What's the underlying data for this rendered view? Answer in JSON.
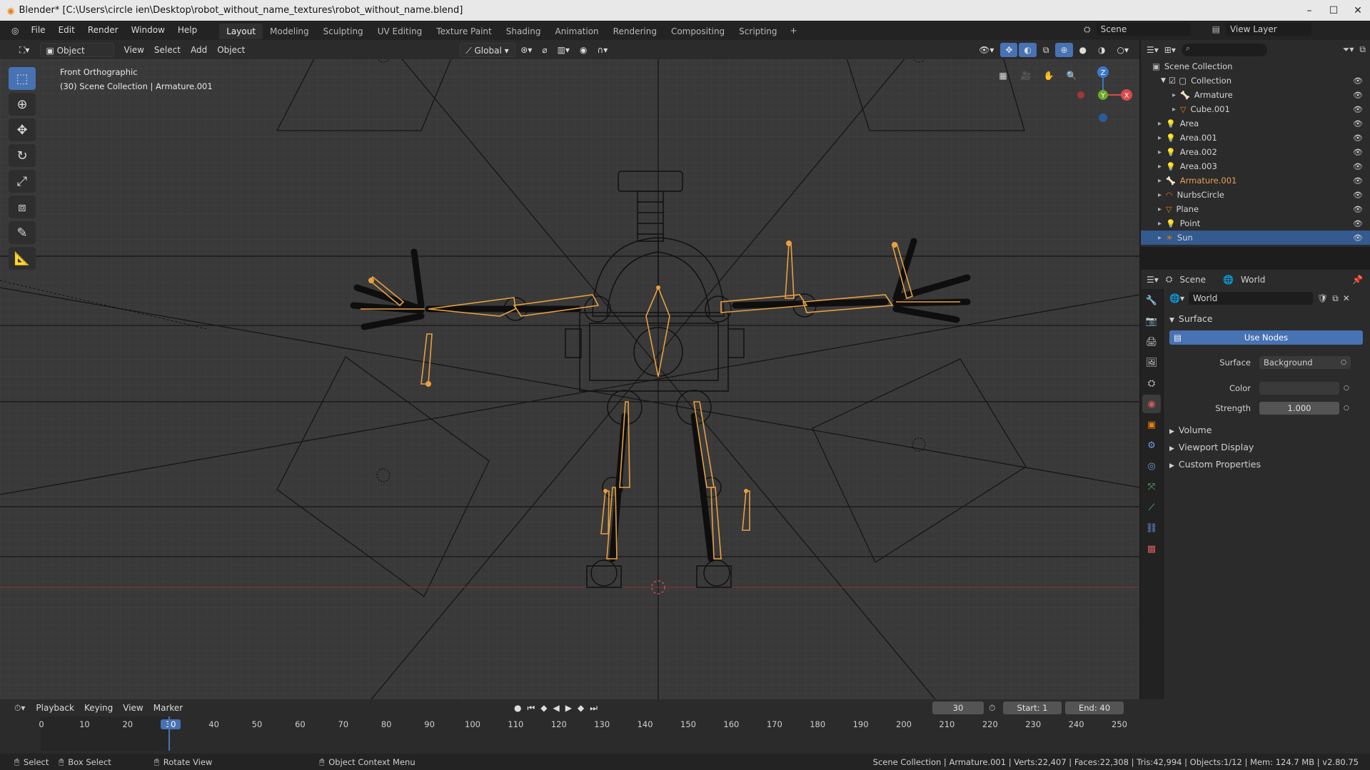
{
  "window": {
    "title": "Blender* [C:\\Users\\circle ien\\Desktop\\robot_without_name_textures\\robot_without_name.blend]"
  },
  "topbar": {
    "menus": [
      "File",
      "Edit",
      "Render",
      "Window",
      "Help"
    ],
    "workspaces": [
      "Layout",
      "Modeling",
      "Sculpting",
      "UV Editing",
      "Texture Paint",
      "Shading",
      "Animation",
      "Rendering",
      "Compositing",
      "Scripting"
    ],
    "active_workspace": "Layout",
    "scene_label": "Scene",
    "view_layer_label": "View Layer"
  },
  "viewport": {
    "mode": "Object Mode",
    "menus": [
      "View",
      "Select",
      "Add",
      "Object"
    ],
    "transform_orientation": "Global",
    "view_name": "Front Orthographic",
    "context": "(30) Scene Collection | Armature.001"
  },
  "outliner": {
    "root": "Scene Collection",
    "collection": "Collection",
    "items": [
      {
        "name": "Armature",
        "indent": 2,
        "color": "#d4d4d4"
      },
      {
        "name": "Cube.001",
        "indent": 2,
        "color": "#d4d4d4"
      },
      {
        "name": "Area",
        "indent": 1,
        "color": "#d4d4d4"
      },
      {
        "name": "Area.001",
        "indent": 1,
        "color": "#d4d4d4"
      },
      {
        "name": "Area.002",
        "indent": 1,
        "color": "#d4d4d4"
      },
      {
        "name": "Area.003",
        "indent": 1,
        "color": "#d4d4d4"
      },
      {
        "name": "Armature.001",
        "indent": 1,
        "color": "#e5a04d"
      },
      {
        "name": "NurbsCircle",
        "indent": 1,
        "color": "#d4d4d4"
      },
      {
        "name": "Plane",
        "indent": 1,
        "color": "#d4d4d4"
      },
      {
        "name": "Point",
        "indent": 1,
        "color": "#d4d4d4"
      },
      {
        "name": "Sun",
        "indent": 1,
        "color": "#d4d4d4",
        "selected": true
      }
    ]
  },
  "properties": {
    "tab_scene": "Scene",
    "tab_world": "World",
    "world_name": "World",
    "panel_surface": "Surface",
    "use_nodes_label": "Use Nodes",
    "surface_label": "Surface",
    "surface_value": "Background",
    "color_label": "Color",
    "strength_label": "Strength",
    "strength_value": "1.000",
    "panel_volume": "Volume",
    "panel_viewport_display": "Viewport Display",
    "panel_custom_properties": "Custom Properties"
  },
  "timeline": {
    "menus": [
      "Playback",
      "Keying",
      "View",
      "Marker"
    ],
    "current_frame": "30",
    "start_label": "Start:",
    "start_value": "1",
    "end_label": "End:",
    "end_value": "40",
    "ticks": [
      "0",
      "10",
      "20",
      "30",
      "40",
      "50",
      "60",
      "70",
      "80",
      "90",
      "100",
      "110",
      "120",
      "130",
      "140",
      "150",
      "160",
      "170",
      "180",
      "190",
      "200",
      "210",
      "220",
      "230",
      "240",
      "250"
    ]
  },
  "statusbar": {
    "select": "Select",
    "box_select": "Box Select",
    "rotate_view": "Rotate View",
    "context_menu": "Object Context Menu",
    "stats": "Scene Collection | Armature.001 | Verts:22,407 | Faces:22,308 | Tris:42,994 | Objects:1/12 | Mem: 124.7 MB | v2.80.75"
  },
  "colors": {
    "accent": "#4772b3",
    "bone_orange": "#e8a040",
    "selected_row": "#345a8f"
  }
}
